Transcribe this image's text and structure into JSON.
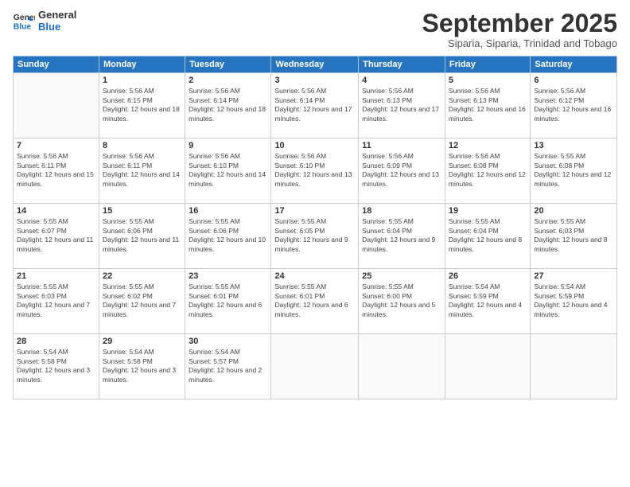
{
  "logo": {
    "line1": "General",
    "line2": "Blue"
  },
  "title": "September 2025",
  "subtitle": "Siparia, Siparia, Trinidad and Tobago",
  "headers": [
    "Sunday",
    "Monday",
    "Tuesday",
    "Wednesday",
    "Thursday",
    "Friday",
    "Saturday"
  ],
  "weeks": [
    [
      {
        "day": "",
        "sunrise": "",
        "sunset": "",
        "daylight": ""
      },
      {
        "day": "1",
        "sunrise": "Sunrise: 5:56 AM",
        "sunset": "Sunset: 6:15 PM",
        "daylight": "Daylight: 12 hours and 18 minutes."
      },
      {
        "day": "2",
        "sunrise": "Sunrise: 5:56 AM",
        "sunset": "Sunset: 6:14 PM",
        "daylight": "Daylight: 12 hours and 18 minutes."
      },
      {
        "day": "3",
        "sunrise": "Sunrise: 5:56 AM",
        "sunset": "Sunset: 6:14 PM",
        "daylight": "Daylight: 12 hours and 17 minutes."
      },
      {
        "day": "4",
        "sunrise": "Sunrise: 5:56 AM",
        "sunset": "Sunset: 6:13 PM",
        "daylight": "Daylight: 12 hours and 17 minutes."
      },
      {
        "day": "5",
        "sunrise": "Sunrise: 5:56 AM",
        "sunset": "Sunset: 6:13 PM",
        "daylight": "Daylight: 12 hours and 16 minutes."
      },
      {
        "day": "6",
        "sunrise": "Sunrise: 5:56 AM",
        "sunset": "Sunset: 6:12 PM",
        "daylight": "Daylight: 12 hours and 16 minutes."
      }
    ],
    [
      {
        "day": "7",
        "sunrise": "Sunrise: 5:56 AM",
        "sunset": "Sunset: 6:11 PM",
        "daylight": "Daylight: 12 hours and 15 minutes."
      },
      {
        "day": "8",
        "sunrise": "Sunrise: 5:56 AM",
        "sunset": "Sunset: 6:11 PM",
        "daylight": "Daylight: 12 hours and 14 minutes."
      },
      {
        "day": "9",
        "sunrise": "Sunrise: 5:56 AM",
        "sunset": "Sunset: 6:10 PM",
        "daylight": "Daylight: 12 hours and 14 minutes."
      },
      {
        "day": "10",
        "sunrise": "Sunrise: 5:56 AM",
        "sunset": "Sunset: 6:10 PM",
        "daylight": "Daylight: 12 hours and 13 minutes."
      },
      {
        "day": "11",
        "sunrise": "Sunrise: 5:56 AM",
        "sunset": "Sunset: 6:09 PM",
        "daylight": "Daylight: 12 hours and 13 minutes."
      },
      {
        "day": "12",
        "sunrise": "Sunrise: 5:56 AM",
        "sunset": "Sunset: 6:08 PM",
        "daylight": "Daylight: 12 hours and 12 minutes."
      },
      {
        "day": "13",
        "sunrise": "Sunrise: 5:55 AM",
        "sunset": "Sunset: 6:08 PM",
        "daylight": "Daylight: 12 hours and 12 minutes."
      }
    ],
    [
      {
        "day": "14",
        "sunrise": "Sunrise: 5:55 AM",
        "sunset": "Sunset: 6:07 PM",
        "daylight": "Daylight: 12 hours and 11 minutes."
      },
      {
        "day": "15",
        "sunrise": "Sunrise: 5:55 AM",
        "sunset": "Sunset: 6:06 PM",
        "daylight": "Daylight: 12 hours and 11 minutes."
      },
      {
        "day": "16",
        "sunrise": "Sunrise: 5:55 AM",
        "sunset": "Sunset: 6:06 PM",
        "daylight": "Daylight: 12 hours and 10 minutes."
      },
      {
        "day": "17",
        "sunrise": "Sunrise: 5:55 AM",
        "sunset": "Sunset: 6:05 PM",
        "daylight": "Daylight: 12 hours and 9 minutes."
      },
      {
        "day": "18",
        "sunrise": "Sunrise: 5:55 AM",
        "sunset": "Sunset: 6:04 PM",
        "daylight": "Daylight: 12 hours and 9 minutes."
      },
      {
        "day": "19",
        "sunrise": "Sunrise: 5:55 AM",
        "sunset": "Sunset: 6:04 PM",
        "daylight": "Daylight: 12 hours and 8 minutes."
      },
      {
        "day": "20",
        "sunrise": "Sunrise: 5:55 AM",
        "sunset": "Sunset: 6:03 PM",
        "daylight": "Daylight: 12 hours and 8 minutes."
      }
    ],
    [
      {
        "day": "21",
        "sunrise": "Sunrise: 5:55 AM",
        "sunset": "Sunset: 6:03 PM",
        "daylight": "Daylight: 12 hours and 7 minutes."
      },
      {
        "day": "22",
        "sunrise": "Sunrise: 5:55 AM",
        "sunset": "Sunset: 6:02 PM",
        "daylight": "Daylight: 12 hours and 7 minutes."
      },
      {
        "day": "23",
        "sunrise": "Sunrise: 5:55 AM",
        "sunset": "Sunset: 6:01 PM",
        "daylight": "Daylight: 12 hours and 6 minutes."
      },
      {
        "day": "24",
        "sunrise": "Sunrise: 5:55 AM",
        "sunset": "Sunset: 6:01 PM",
        "daylight": "Daylight: 12 hours and 6 minutes."
      },
      {
        "day": "25",
        "sunrise": "Sunrise: 5:55 AM",
        "sunset": "Sunset: 6:00 PM",
        "daylight": "Daylight: 12 hours and 5 minutes."
      },
      {
        "day": "26",
        "sunrise": "Sunrise: 5:54 AM",
        "sunset": "Sunset: 5:59 PM",
        "daylight": "Daylight: 12 hours and 4 minutes."
      },
      {
        "day": "27",
        "sunrise": "Sunrise: 5:54 AM",
        "sunset": "Sunset: 5:59 PM",
        "daylight": "Daylight: 12 hours and 4 minutes."
      }
    ],
    [
      {
        "day": "28",
        "sunrise": "Sunrise: 5:54 AM",
        "sunset": "Sunset: 5:58 PM",
        "daylight": "Daylight: 12 hours and 3 minutes."
      },
      {
        "day": "29",
        "sunrise": "Sunrise: 5:54 AM",
        "sunset": "Sunset: 5:58 PM",
        "daylight": "Daylight: 12 hours and 3 minutes."
      },
      {
        "day": "30",
        "sunrise": "Sunrise: 5:54 AM",
        "sunset": "Sunset: 5:57 PM",
        "daylight": "Daylight: 12 hours and 2 minutes."
      },
      {
        "day": "",
        "sunrise": "",
        "sunset": "",
        "daylight": ""
      },
      {
        "day": "",
        "sunrise": "",
        "sunset": "",
        "daylight": ""
      },
      {
        "day": "",
        "sunrise": "",
        "sunset": "",
        "daylight": ""
      },
      {
        "day": "",
        "sunrise": "",
        "sunset": "",
        "daylight": ""
      }
    ]
  ]
}
